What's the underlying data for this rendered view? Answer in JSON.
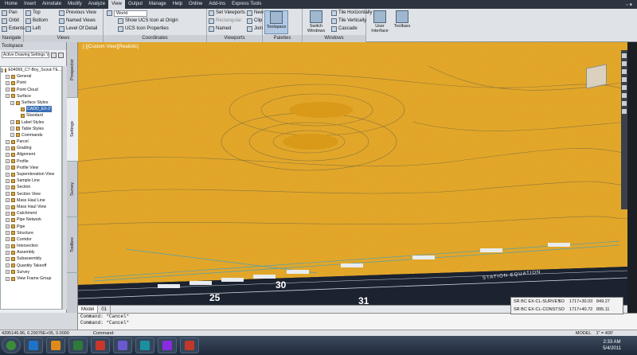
{
  "menu": {
    "tabs": [
      "Home",
      "Insert",
      "Annotate",
      "Modify",
      "Analyze",
      "View",
      "Output",
      "Manage",
      "Help",
      "Online",
      "Add-Ins",
      "Express Tools"
    ],
    "active": "View"
  },
  "ribbon": {
    "navigate": {
      "title": "Navigate",
      "items": [
        "Pan",
        "Orbit",
        "Extents"
      ]
    },
    "views": {
      "title": "Views",
      "items": [
        "Top",
        "Bottom",
        "Left",
        "Previous View",
        "Named Views",
        "Level Of Detail"
      ]
    },
    "coordinates": {
      "title": "Coordinates",
      "world": "World",
      "items": [
        "Show UCS Icon at Origin",
        "UCS Icon Properties"
      ]
    },
    "viewports": {
      "title": "Viewports",
      "items": [
        "Set Viewports",
        "Rectangular",
        "Named",
        "New",
        "Clip",
        "Join"
      ]
    },
    "palettes": {
      "title": "Palettes",
      "toolspace": "Toolspace"
    },
    "windows": {
      "title": "Windows",
      "items": [
        "Switch Windows",
        "Tile Horizontally",
        "Tile Vertically",
        "Cascade"
      ]
    },
    "ui": {
      "user_interface": "User Interface",
      "toolbars": "Toolbars"
    }
  },
  "toolspace": {
    "title": "Toolspace",
    "dropdown": "Active Drawing Settings View",
    "drawing": "E04069_C7-Boy_Scout-TE...",
    "tree": [
      {
        "label": "General",
        "level": 1,
        "sel": false
      },
      {
        "label": "Point",
        "level": 1,
        "sel": false
      },
      {
        "label": "Point Cloud",
        "level": 1,
        "sel": false
      },
      {
        "label": "Surface",
        "level": 1,
        "sel": false
      },
      {
        "label": "Surface Styles",
        "level": 2,
        "sel": false
      },
      {
        "label": "CADD_EX-2'",
        "level": 3,
        "sel": true
      },
      {
        "label": "Standard",
        "level": 3,
        "sel": false
      },
      {
        "label": "Label Styles",
        "level": 2,
        "sel": false
      },
      {
        "label": "Table Styles",
        "level": 2,
        "sel": false
      },
      {
        "label": "Commands",
        "level": 2,
        "sel": false
      },
      {
        "label": "Parcel",
        "level": 1,
        "sel": false
      },
      {
        "label": "Grading",
        "level": 1,
        "sel": false
      },
      {
        "label": "Alignment",
        "level": 1,
        "sel": false
      },
      {
        "label": "Profile",
        "level": 1,
        "sel": false
      },
      {
        "label": "Profile View",
        "level": 1,
        "sel": false
      },
      {
        "label": "Superelevation View",
        "level": 1,
        "sel": false
      },
      {
        "label": "Sample Line",
        "level": 1,
        "sel": false
      },
      {
        "label": "Section",
        "level": 1,
        "sel": false
      },
      {
        "label": "Section View",
        "level": 1,
        "sel": false
      },
      {
        "label": "Mass Haul Line",
        "level": 1,
        "sel": false
      },
      {
        "label": "Mass Haul View",
        "level": 1,
        "sel": false
      },
      {
        "label": "Catchment",
        "level": 1,
        "sel": false
      },
      {
        "label": "Pipe Network",
        "level": 1,
        "sel": false
      },
      {
        "label": "Pipe",
        "level": 1,
        "sel": false
      },
      {
        "label": "Structure",
        "level": 1,
        "sel": false
      },
      {
        "label": "Corridor",
        "level": 1,
        "sel": false
      },
      {
        "label": "Intersection",
        "level": 1,
        "sel": false
      },
      {
        "label": "Assembly",
        "level": 1,
        "sel": false
      },
      {
        "label": "Subassembly",
        "level": 1,
        "sel": false
      },
      {
        "label": "Quantity Takeoff",
        "level": 1,
        "sel": false
      },
      {
        "label": "Survey",
        "level": 1,
        "sel": false
      },
      {
        "label": "View Frame Group",
        "level": 1,
        "sel": false
      }
    ],
    "vtabs": [
      "Prospector",
      "Settings",
      "Survey",
      "Toolbox"
    ]
  },
  "viewport": {
    "label": "[-][Custom View][Realistic]",
    "stations": [
      "25",
      "30",
      "31"
    ],
    "annotation": "STATION EQUATION"
  },
  "tooltip": {
    "rows": [
      {
        "name": "SR BC EX-CL-SURVEY",
        "type": "SO",
        "station": "1717+30.03",
        "value": "849.27"
      },
      {
        "name": "SR BC EX-CL-CONST",
        "type": "SO",
        "station": "1717+40.72",
        "value": "895.11"
      }
    ]
  },
  "model_tabs": [
    "Model",
    "01"
  ],
  "command": {
    "lines": [
      "Command: *Cancel*",
      "Command: *Cancel*",
      "Command:"
    ]
  },
  "status": {
    "coords": "4395146.86, 6.29076E+05, 0.0000",
    "model": "MODEL",
    "scale": "1\" = 400'"
  },
  "taskbar": {
    "time": "2:33 AM",
    "date": "5/4/2011",
    "colors": [
      "#1e73c8",
      "#e08a1a",
      "#2f7a3a",
      "#c9362c",
      "#6a5acd",
      "#1a8fa0",
      "#8a2be2",
      "#c0392b"
    ]
  }
}
